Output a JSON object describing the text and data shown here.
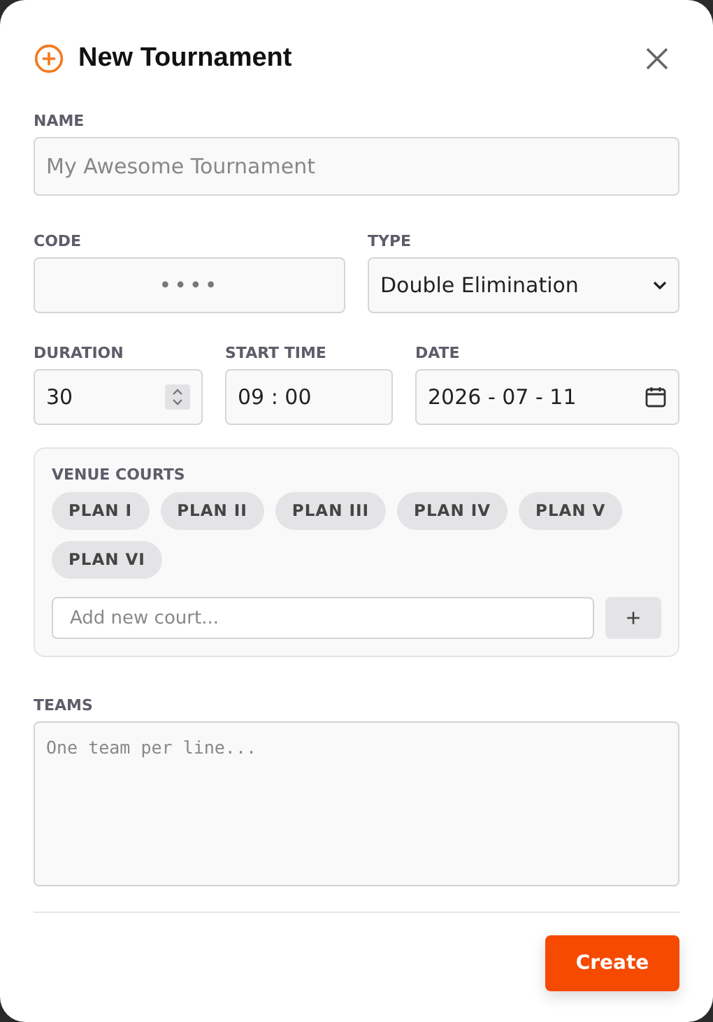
{
  "dialog": {
    "title": "New Tournament"
  },
  "name": {
    "label": "NAME",
    "placeholder": "My Awesome Tournament"
  },
  "code": {
    "label": "CODE",
    "placeholder": "••••"
  },
  "type": {
    "label": "TYPE",
    "value": "Double Elimination"
  },
  "duration": {
    "label": "DURATION",
    "value": "30"
  },
  "start_time": {
    "label": "START TIME",
    "value": "09 : 00"
  },
  "date": {
    "label": "DATE",
    "value": "2026 - 07 - 11"
  },
  "venue_courts": {
    "label": "VENUE COURTS",
    "courts": [
      "PLAN I",
      "PLAN II",
      "PLAN III",
      "PLAN IV",
      "PLAN V",
      "PLAN VI"
    ],
    "add_placeholder": "Add new court...",
    "add_button": "+"
  },
  "teams": {
    "label": "TEAMS",
    "placeholder": "One team per line..."
  },
  "buttons": [
    "Create"
  ]
}
